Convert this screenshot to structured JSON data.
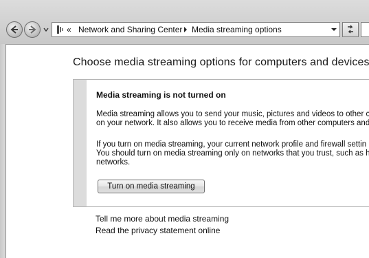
{
  "address_bar": {
    "chevrons": "«",
    "breadcrumbs": [
      "Network and Sharing Center",
      "Media streaming options"
    ]
  },
  "icons": {
    "back": "back-arrow-icon",
    "forward": "forward-arrow-icon",
    "location": "network-folder-icon",
    "refresh": "refresh-icon"
  },
  "main": {
    "title": "Choose media streaming options for computers and devices",
    "panel": {
      "heading": "Media streaming is not turned on",
      "paragraph1": [
        "Media streaming allows you to send your music, pictures and videos to other c",
        "on your network.  It also allows you to receive media from other computers and"
      ],
      "paragraph2": [
        "If you turn on media streaming, your current network profile and firewall settin",
        "You should turn on media streaming only on networks that you trust, such as h",
        "networks."
      ],
      "button_label": "Turn on media streaming"
    },
    "links": [
      "Tell me more about media streaming",
      "Read the privacy statement online"
    ]
  },
  "colors": {
    "chrome": "#d2d2d2",
    "panel_stripe": "#dcdcdc",
    "panel_border": "#b5b5b5"
  }
}
